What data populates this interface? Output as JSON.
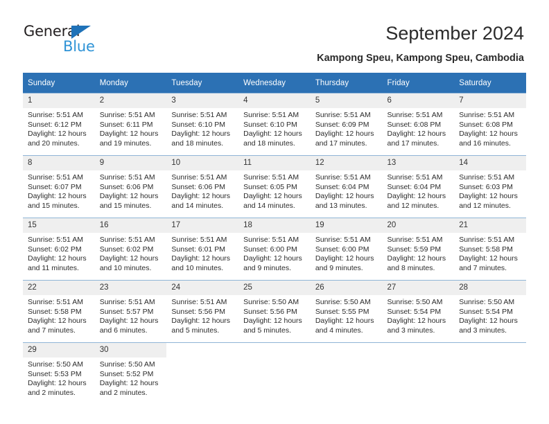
{
  "brand": {
    "name_part1": "General",
    "name_part2": "Blue",
    "triangle_icon": "triangle-icon",
    "accent_color": "#1f72b8",
    "secondary_color": "#2e93d6"
  },
  "header": {
    "title": "September 2024",
    "subtitle": "Kampong Speu, Kampong Speu, Cambodia"
  },
  "colors": {
    "header_blue": "#2c71b4",
    "day_band_gray": "#efefef",
    "row_divider": "#8fb4d6",
    "text": "#2b2b2b"
  },
  "weekdays": [
    "Sunday",
    "Monday",
    "Tuesday",
    "Wednesday",
    "Thursday",
    "Friday",
    "Saturday"
  ],
  "labels": {
    "sunrise_prefix": "Sunrise:",
    "sunset_prefix": "Sunset:",
    "daylight_prefix": "Daylight:"
  },
  "weeks": [
    [
      {
        "day": "1",
        "sunrise": "Sunrise: 5:51 AM",
        "sunset": "Sunset: 6:12 PM",
        "daylight": "Daylight: 12 hours and 20 minutes."
      },
      {
        "day": "2",
        "sunrise": "Sunrise: 5:51 AM",
        "sunset": "Sunset: 6:11 PM",
        "daylight": "Daylight: 12 hours and 19 minutes."
      },
      {
        "day": "3",
        "sunrise": "Sunrise: 5:51 AM",
        "sunset": "Sunset: 6:10 PM",
        "daylight": "Daylight: 12 hours and 18 minutes."
      },
      {
        "day": "4",
        "sunrise": "Sunrise: 5:51 AM",
        "sunset": "Sunset: 6:10 PM",
        "daylight": "Daylight: 12 hours and 18 minutes."
      },
      {
        "day": "5",
        "sunrise": "Sunrise: 5:51 AM",
        "sunset": "Sunset: 6:09 PM",
        "daylight": "Daylight: 12 hours and 17 minutes."
      },
      {
        "day": "6",
        "sunrise": "Sunrise: 5:51 AM",
        "sunset": "Sunset: 6:08 PM",
        "daylight": "Daylight: 12 hours and 17 minutes."
      },
      {
        "day": "7",
        "sunrise": "Sunrise: 5:51 AM",
        "sunset": "Sunset: 6:08 PM",
        "daylight": "Daylight: 12 hours and 16 minutes."
      }
    ],
    [
      {
        "day": "8",
        "sunrise": "Sunrise: 5:51 AM",
        "sunset": "Sunset: 6:07 PM",
        "daylight": "Daylight: 12 hours and 15 minutes."
      },
      {
        "day": "9",
        "sunrise": "Sunrise: 5:51 AM",
        "sunset": "Sunset: 6:06 PM",
        "daylight": "Daylight: 12 hours and 15 minutes."
      },
      {
        "day": "10",
        "sunrise": "Sunrise: 5:51 AM",
        "sunset": "Sunset: 6:06 PM",
        "daylight": "Daylight: 12 hours and 14 minutes."
      },
      {
        "day": "11",
        "sunrise": "Sunrise: 5:51 AM",
        "sunset": "Sunset: 6:05 PM",
        "daylight": "Daylight: 12 hours and 14 minutes."
      },
      {
        "day": "12",
        "sunrise": "Sunrise: 5:51 AM",
        "sunset": "Sunset: 6:04 PM",
        "daylight": "Daylight: 12 hours and 13 minutes."
      },
      {
        "day": "13",
        "sunrise": "Sunrise: 5:51 AM",
        "sunset": "Sunset: 6:04 PM",
        "daylight": "Daylight: 12 hours and 12 minutes."
      },
      {
        "day": "14",
        "sunrise": "Sunrise: 5:51 AM",
        "sunset": "Sunset: 6:03 PM",
        "daylight": "Daylight: 12 hours and 12 minutes."
      }
    ],
    [
      {
        "day": "15",
        "sunrise": "Sunrise: 5:51 AM",
        "sunset": "Sunset: 6:02 PM",
        "daylight": "Daylight: 12 hours and 11 minutes."
      },
      {
        "day": "16",
        "sunrise": "Sunrise: 5:51 AM",
        "sunset": "Sunset: 6:02 PM",
        "daylight": "Daylight: 12 hours and 10 minutes."
      },
      {
        "day": "17",
        "sunrise": "Sunrise: 5:51 AM",
        "sunset": "Sunset: 6:01 PM",
        "daylight": "Daylight: 12 hours and 10 minutes."
      },
      {
        "day": "18",
        "sunrise": "Sunrise: 5:51 AM",
        "sunset": "Sunset: 6:00 PM",
        "daylight": "Daylight: 12 hours and 9 minutes."
      },
      {
        "day": "19",
        "sunrise": "Sunrise: 5:51 AM",
        "sunset": "Sunset: 6:00 PM",
        "daylight": "Daylight: 12 hours and 9 minutes."
      },
      {
        "day": "20",
        "sunrise": "Sunrise: 5:51 AM",
        "sunset": "Sunset: 5:59 PM",
        "daylight": "Daylight: 12 hours and 8 minutes."
      },
      {
        "day": "21",
        "sunrise": "Sunrise: 5:51 AM",
        "sunset": "Sunset: 5:58 PM",
        "daylight": "Daylight: 12 hours and 7 minutes."
      }
    ],
    [
      {
        "day": "22",
        "sunrise": "Sunrise: 5:51 AM",
        "sunset": "Sunset: 5:58 PM",
        "daylight": "Daylight: 12 hours and 7 minutes."
      },
      {
        "day": "23",
        "sunrise": "Sunrise: 5:51 AM",
        "sunset": "Sunset: 5:57 PM",
        "daylight": "Daylight: 12 hours and 6 minutes."
      },
      {
        "day": "24",
        "sunrise": "Sunrise: 5:51 AM",
        "sunset": "Sunset: 5:56 PM",
        "daylight": "Daylight: 12 hours and 5 minutes."
      },
      {
        "day": "25",
        "sunrise": "Sunrise: 5:50 AM",
        "sunset": "Sunset: 5:56 PM",
        "daylight": "Daylight: 12 hours and 5 minutes."
      },
      {
        "day": "26",
        "sunrise": "Sunrise: 5:50 AM",
        "sunset": "Sunset: 5:55 PM",
        "daylight": "Daylight: 12 hours and 4 minutes."
      },
      {
        "day": "27",
        "sunrise": "Sunrise: 5:50 AM",
        "sunset": "Sunset: 5:54 PM",
        "daylight": "Daylight: 12 hours and 3 minutes."
      },
      {
        "day": "28",
        "sunrise": "Sunrise: 5:50 AM",
        "sunset": "Sunset: 5:54 PM",
        "daylight": "Daylight: 12 hours and 3 minutes."
      }
    ],
    [
      {
        "day": "29",
        "sunrise": "Sunrise: 5:50 AM",
        "sunset": "Sunset: 5:53 PM",
        "daylight": "Daylight: 12 hours and 2 minutes."
      },
      {
        "day": "30",
        "sunrise": "Sunrise: 5:50 AM",
        "sunset": "Sunset: 5:52 PM",
        "daylight": "Daylight: 12 hours and 2 minutes."
      },
      {
        "day": "",
        "sunrise": "",
        "sunset": "",
        "daylight": ""
      },
      {
        "day": "",
        "sunrise": "",
        "sunset": "",
        "daylight": ""
      },
      {
        "day": "",
        "sunrise": "",
        "sunset": "",
        "daylight": ""
      },
      {
        "day": "",
        "sunrise": "",
        "sunset": "",
        "daylight": ""
      },
      {
        "day": "",
        "sunrise": "",
        "sunset": "",
        "daylight": ""
      }
    ]
  ]
}
